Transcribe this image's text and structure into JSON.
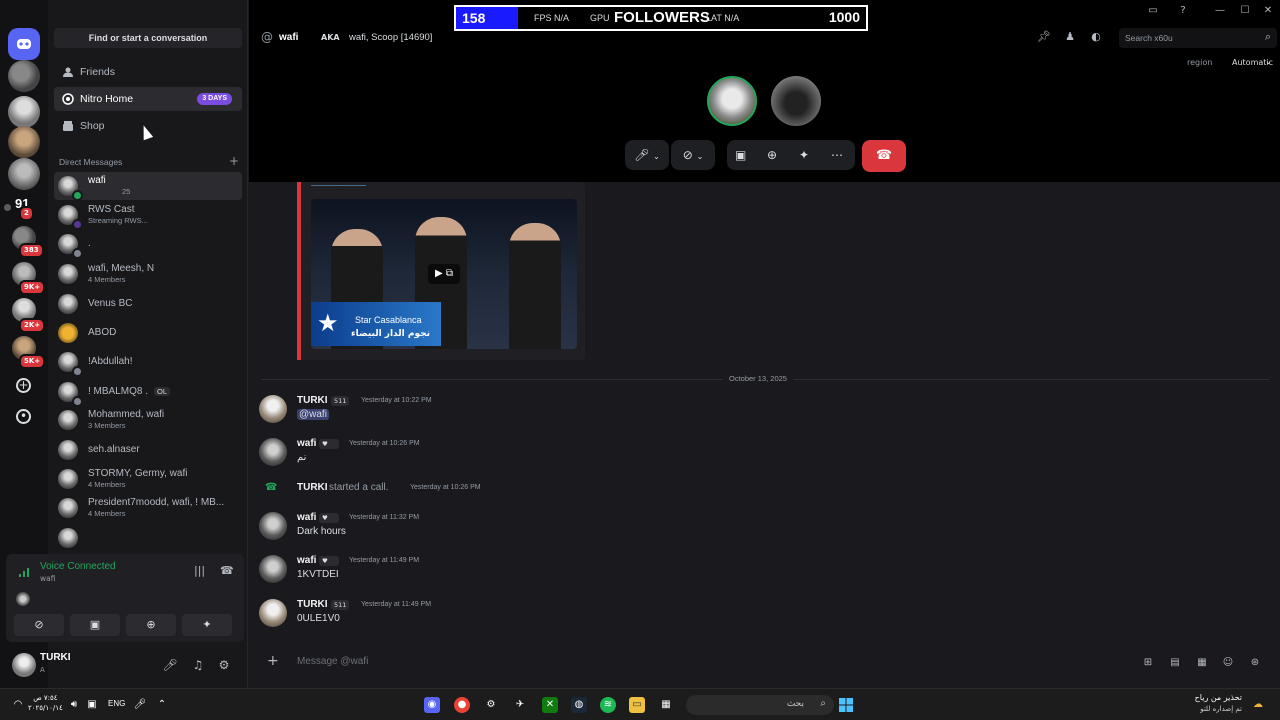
{
  "overlay": {
    "count": "158",
    "fps_label": "FPS",
    "fps_value": "N/A",
    "gpu_label": "GPU",
    "title": "FOLLOWERS",
    "lat_label": "LAT",
    "lat_value": "N/A",
    "goal": "1000",
    "behind_title": "Direct Messages"
  },
  "rail": {
    "badges": [
      "2",
      "383",
      "9K+",
      "2K+",
      "5K+"
    ],
    "number_label": "91"
  },
  "sidebar": {
    "find_label": "Find or start a conversation",
    "nav": [
      {
        "label": "Friends",
        "icon": "friends-icon"
      },
      {
        "label": "Nitro Home",
        "icon": "nitro-icon",
        "badge": "3 DAYS"
      },
      {
        "label": "Shop",
        "icon": "shop-icon"
      }
    ],
    "dm_header": "Direct Messages",
    "dms": [
      {
        "name": "wafi",
        "sub": "25",
        "online": true
      },
      {
        "name": "RWS Cast",
        "sub": "Streaming RWS...",
        "online": false
      },
      {
        "name": ".",
        "sub": "",
        "online": false
      },
      {
        "name": "wafi, Meesh, N",
        "sub": "4 Members",
        "online": false
      },
      {
        "name": "Venus BC",
        "sub": "",
        "online": false
      },
      {
        "name": "ABOD",
        "sub": "",
        "online": false
      },
      {
        "name": "!Abdullah!",
        "sub": "",
        "online": false
      },
      {
        "name": "! MBALMQ8 .",
        "sub": "",
        "online": false,
        "tag": "OL"
      },
      {
        "name": "Mohammed, wafi",
        "sub": "3 Members",
        "online": false
      },
      {
        "name": "seh.alnaser",
        "sub": "",
        "online": false
      },
      {
        "name": "STORMY, Germy, wafi",
        "sub": "4 Members",
        "online": false
      },
      {
        "name": "President7moodd, wafi, ! MB...",
        "sub": "4 Members",
        "online": false
      }
    ],
    "voice": {
      "title": "Voice Connected",
      "sub": "wafi"
    },
    "user": {
      "name": "TURKI",
      "status": "A"
    }
  },
  "header": {
    "name": "wafi",
    "aka": "AKA",
    "aka_text": "wafi, Scoop [14690]",
    "search_placeholder": "Search x60u",
    "region_label": "region",
    "region_value": "Automatic"
  },
  "embed": {
    "star_en": "Star Casablanca",
    "star_ar": "نجوم الدار البيضاء"
  },
  "date_divider": "October 13, 2025",
  "messages": [
    {
      "author": "TURKI",
      "tag": "511",
      "ts": "Yesterday at 10:22 PM",
      "text": "@wafi",
      "mention": true,
      "avatar": "turki"
    },
    {
      "author": "wafi",
      "tag": "",
      "ts": "Yesterday at 10:26 PM",
      "text": "نم",
      "avatar": "wafi"
    },
    {
      "author": "wafi",
      "tag": "",
      "ts": "Yesterday at 11:32 PM",
      "text": "Dark hours",
      "avatar": "wafi"
    },
    {
      "author": "wafi",
      "tag": "",
      "ts": "Yesterday at 11:49 PM",
      "text": "1KVTDEI",
      "avatar": "wafi"
    },
    {
      "author": "TURKI",
      "tag": "511",
      "ts": "Yesterday at 11:49 PM",
      "text": "0ULE1V0",
      "avatar": "turki"
    }
  ],
  "call_event": {
    "author": "TURKI",
    "text": "started a call.",
    "ts": "Yesterday at 10:26 PM"
  },
  "composer": {
    "placeholder": "Message @wafi"
  },
  "taskbar": {
    "lang": "ENG",
    "time": "٧:٥٤ ص",
    "date": "٢٠٢٥/١٠/١٤",
    "search": "بحث",
    "notif_title": "تحذير من رياح",
    "notif_sub": "تم إصداره للتو"
  },
  "colors": {
    "accent": "#5865f2",
    "danger": "#da373c",
    "online": "#23a55a",
    "nitro": "#7a4ce0"
  }
}
